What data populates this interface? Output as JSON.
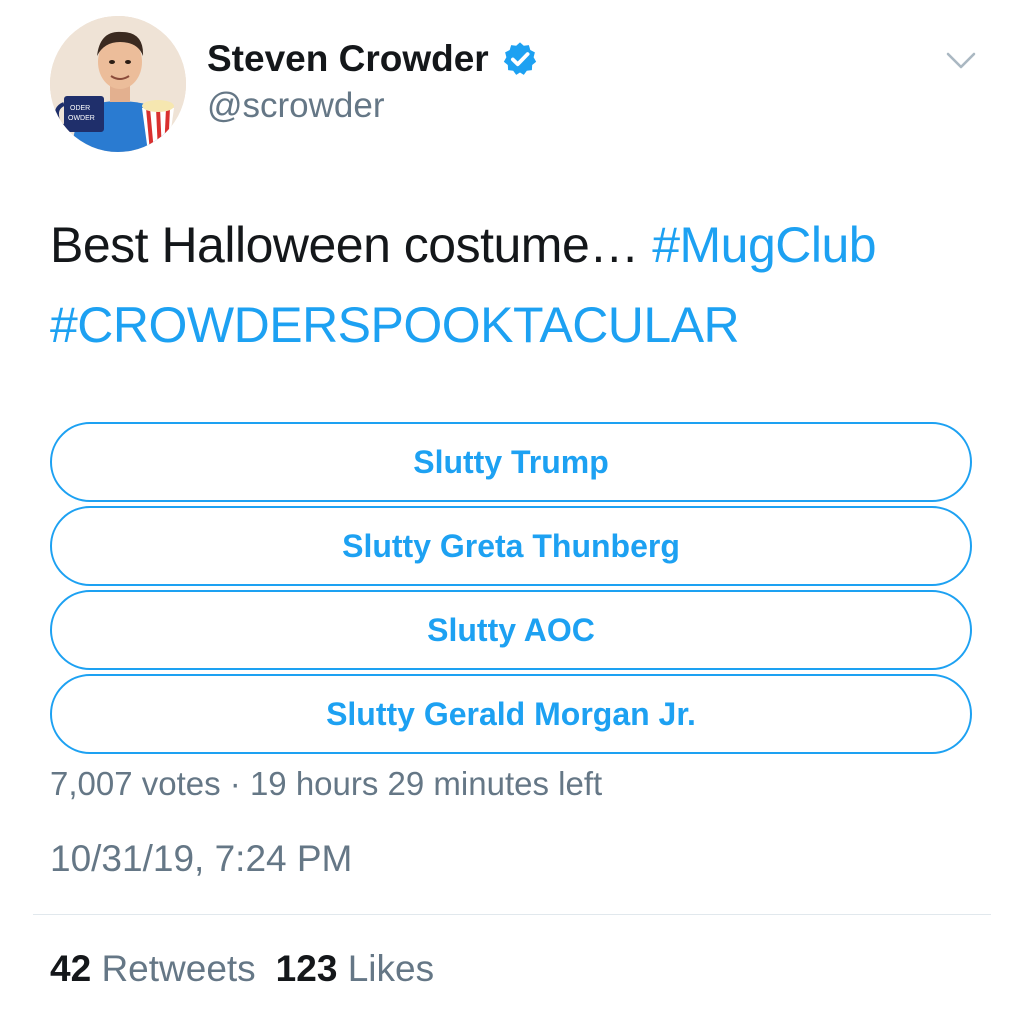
{
  "author": {
    "display_name": "Steven Crowder",
    "handle": "@scrowder",
    "verified": true,
    "avatar_icon": "avatar-photo",
    "mug_text_line1": "ODER",
    "mug_text_line2": "OWDER"
  },
  "tweet": {
    "text_plain": "Best Halloween costume…",
    "hashtag_1": "#MugClub",
    "hashtag_2": "#CROWDERSPOOKTACULAR"
  },
  "poll": {
    "options": [
      {
        "label": "Slutty Trump"
      },
      {
        "label": "Slutty Greta Thunberg"
      },
      {
        "label": "Slutty AOC"
      },
      {
        "label": "Slutty Gerald Morgan Jr."
      }
    ],
    "meta": "7,007 votes · 19 hours 29 minutes left"
  },
  "timestamp": "10/31/19, 7:24 PM",
  "stats": {
    "retweets_count": "42",
    "retweets_label": "Retweets",
    "likes_count": "123",
    "likes_label": "Likes"
  },
  "colors": {
    "accent": "#1da1f2",
    "text": "#14171a",
    "secondary": "#657786",
    "divider": "#e1e8ed"
  },
  "icons": {
    "verified": "verified-badge-icon",
    "more": "chevron-down-icon"
  }
}
